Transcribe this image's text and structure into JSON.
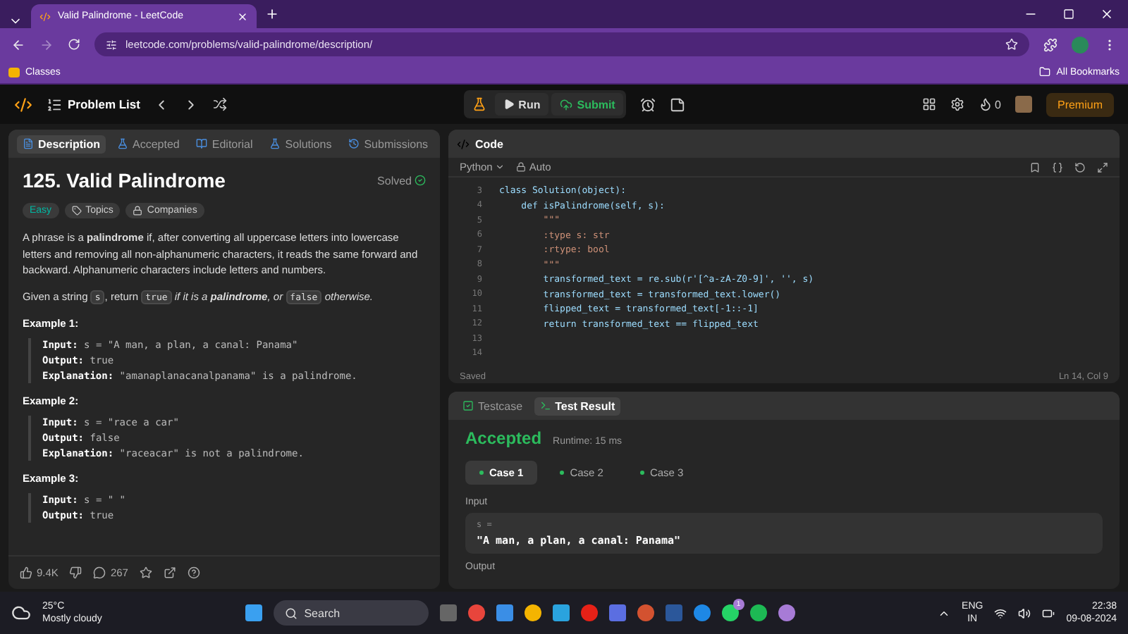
{
  "browser": {
    "tab_title": "Valid Palindrome - LeetCode",
    "url": "leetcode.com/problems/valid-palindrome/description/",
    "bookmarks": [
      "Classes"
    ],
    "all_bookmarks": "All Bookmarks"
  },
  "navbar": {
    "problem_list": "Problem List",
    "run": "Run",
    "submit": "Submit",
    "streak": "0",
    "premium": "Premium"
  },
  "left_tabs": [
    {
      "label": "Description",
      "selected": true
    },
    {
      "label": "Accepted",
      "selected": false
    },
    {
      "label": "Editorial",
      "selected": false
    },
    {
      "label": "Solutions",
      "selected": false
    },
    {
      "label": "Submissions",
      "selected": false
    }
  ],
  "problem": {
    "title": "125. Valid Palindrome",
    "status": "Solved",
    "difficulty": "Easy",
    "tags": [
      "Topics",
      "Companies"
    ],
    "paragraphs": [
      [
        {
          "kind": "text",
          "text": "A phrase is a **palindrome** if, after converting all uppercase letters into lowercase letters and removing all non-alphanumeric characters, it reads the same forward and backward. Alphanumeric characters include letters and numbers."
        }
      ],
      [
        {
          "kind": "text",
          "text": "Given a string "
        },
        {
          "kind": "code",
          "text": "s"
        },
        {
          "kind": "text",
          "text": ", return "
        },
        {
          "kind": "code",
          "text": "true"
        },
        {
          "kind": "italic",
          "text": " if it is a **palindrome**, or "
        },
        {
          "kind": "code",
          "text": "false"
        },
        {
          "kind": "italic",
          "text": " otherwise."
        }
      ]
    ],
    "examples": [
      {
        "title": "Example 1:",
        "lines": [
          {
            "label": "Input:",
            "value": "s = \"A man, a plan, a canal: Panama\""
          },
          {
            "label": "Output:",
            "value": "true"
          },
          {
            "label": "Explanation:",
            "value": "\"amanaplanacanalpanama\" is a palindrome."
          }
        ]
      },
      {
        "title": "Example 2:",
        "lines": [
          {
            "label": "Input:",
            "value": "s = \"race a car\""
          },
          {
            "label": "Output:",
            "value": "false"
          },
          {
            "label": "Explanation:",
            "value": "\"raceacar\" is not a palindrome."
          }
        ]
      },
      {
        "title": "Example 3:",
        "lines": [
          {
            "label": "Input:",
            "value": "s = \" \""
          },
          {
            "label": "Output:",
            "value": "true"
          }
        ]
      }
    ],
    "likes": "9.4K",
    "comments": "267"
  },
  "code_panel": {
    "title": "Code",
    "language": "Python",
    "mode": "Auto",
    "lines": [
      {
        "number": "3",
        "text": "class Solution(object):",
        "kind": "code"
      },
      {
        "number": "4",
        "text": "    def isPalindrome(self, s):",
        "kind": "code"
      },
      {
        "number": "5",
        "text": "        \"\"\"",
        "kind": "doc"
      },
      {
        "number": "6",
        "text": "        :type s: str",
        "kind": "doc"
      },
      {
        "number": "7",
        "text": "        :rtype: bool",
        "kind": "doc"
      },
      {
        "number": "8",
        "text": "        \"\"\"",
        "kind": "doc"
      },
      {
        "number": "9",
        "text": "        transformed_text = re.sub(r'[^a-zA-Z0-9]', '', s)",
        "kind": "code"
      },
      {
        "number": "10",
        "text": "        transformed_text = transformed_text.lower()",
        "kind": "code"
      },
      {
        "number": "11",
        "text": "        flipped_text = transformed_text[-1::-1]",
        "kind": "code"
      },
      {
        "number": "12",
        "text": "        return transformed_text == flipped_text",
        "kind": "code"
      },
      {
        "number": "13"
      },
      {
        "number": "14"
      }
    ],
    "saved": "Saved",
    "cursor": "Ln 14, Col 9"
  },
  "result_panel": {
    "tabs": [
      {
        "label": "Testcase",
        "selected": false
      },
      {
        "label": "Test Result",
        "selected": true
      }
    ],
    "verdict": "Accepted",
    "runtime": "Runtime: 15 ms",
    "cases": [
      {
        "label": "Case 1",
        "selected": true
      },
      {
        "label": "Case 2",
        "selected": false
      },
      {
        "label": "Case 3",
        "selected": false
      }
    ],
    "input_label": "Input",
    "param": "s =",
    "input_value": "\"A man, a plan, a canal: Panama\"",
    "output_label": "Output"
  },
  "taskbar": {
    "temperature": "25°C",
    "weather": "Mostly cloudy",
    "search": "Search",
    "badge": "1",
    "lang": "ENG",
    "region": "IN",
    "time": "22:38",
    "date": "09-08-2024"
  }
}
